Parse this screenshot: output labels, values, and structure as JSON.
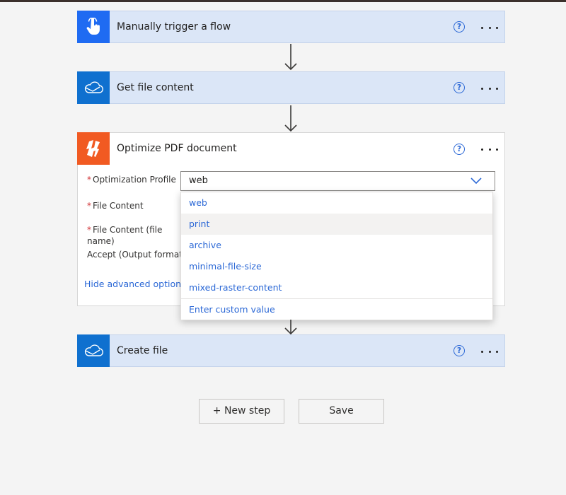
{
  "steps": {
    "trigger": {
      "title": "Manually trigger a flow",
      "icon": "hand-tap-icon",
      "color": "#1f6bf2"
    },
    "get_file": {
      "title": "Get file content",
      "icon": "onedrive-cloud-icon",
      "color": "#0f70cf"
    },
    "optimize": {
      "title": "Optimize PDF document",
      "icon": "nitro-pdf-icon",
      "color": "#f15a22",
      "fields": {
        "profile": {
          "label": "Optimization Profile",
          "required": "*",
          "value": "web"
        },
        "file_content": {
          "label": "File Content",
          "required": "*"
        },
        "file_name": {
          "label": "File Content (file name)",
          "required": "*"
        },
        "accept": {
          "label": "Accept (Output format)"
        }
      },
      "hide_advanced": "Hide advanced options"
    },
    "create_file": {
      "title": "Create file",
      "icon": "onedrive-cloud-icon",
      "color": "#0f70cf"
    }
  },
  "dropdown": {
    "options": [
      "web",
      "print",
      "archive",
      "minimal-file-size",
      "mixed-raster-content"
    ],
    "hovered": "print",
    "custom": "Enter custom value"
  },
  "help_glyph": "?",
  "buttons": {
    "new_step": "+ New step",
    "save": "Save"
  },
  "colors": {
    "link": "#2b68d6",
    "card_bg": "#dbe6f7",
    "required": "#d13438"
  }
}
